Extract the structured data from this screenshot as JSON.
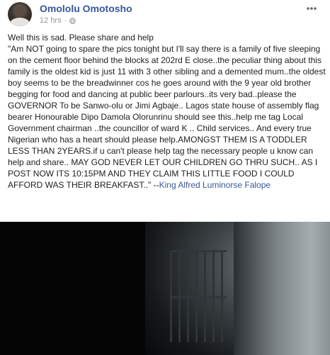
{
  "post": {
    "author": "Omololu Omotosho",
    "timestamp": "12 hrs",
    "separator": "·",
    "privacy_icon": "globe-icon",
    "more_icon": "more-options-icon",
    "body_intro": "Well this is sad. Please share and help",
    "body_quote": "\"Am NOT going to spare the pics tonight but I'll say there is a family of five sleeping on the cement floor behind the blocks at 202rd E close..the peculiar thing about this family is the oldest kid is just 11 with 3 other sibling and a demented mum..the oldest boy seems to be the breadwinner cos he goes around with the 9 year old brother begging for food and dancing at public beer parlours..its very bad..please the GOVERNOR To be Sanwo-olu or Jimi Agbaje.. Lagos state house of assembly flag bearer Honourable Dipo Damola Olorunrinu should see this..help me tag Local Government chairman ..the councillor of ward K .. Child services.. And every true Nigerian who has a heart should please help.AMONGST THEM IS A TODDLER LESS THAN 2YEARS.if u can't please help tag the necessary people u know can help and share.. MAY GOD NEVER LET OUR CHILDREN GO THRU SUCH.. AS I POST NOW ITS 10:15PM AND THEY CLAIM THIS LITTLE FOOD I COULD AFFORD WAS THEIR BREAKFAST..\" --",
    "quote_credit": "King Alfred Luminorse Falope"
  },
  "colors": {
    "link": "#385898",
    "meta": "#90949c",
    "text": "#1c1e21",
    "photo_bg": "#050506"
  }
}
